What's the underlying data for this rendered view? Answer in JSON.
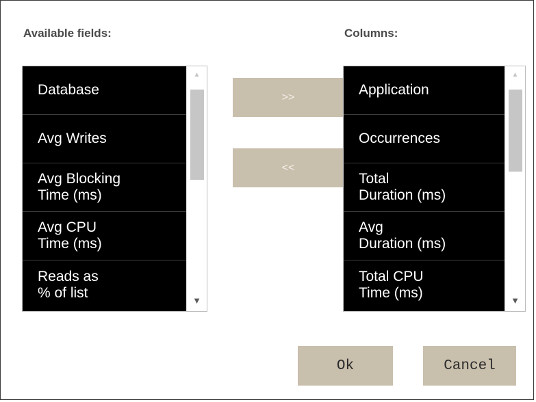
{
  "labels": {
    "available": "Available fields:",
    "columns": "Columns:"
  },
  "available_fields": [
    "Database",
    "Avg Writes",
    "Avg Blocking\nTime (ms)",
    "Avg CPU\nTime (ms)",
    "Reads as\n% of list"
  ],
  "columns": [
    "Application",
    "Occurrences",
    "Total\nDuration (ms)",
    "Avg\nDuration (ms)",
    "Total CPU\nTime (ms)"
  ],
  "buttons": {
    "add": ">>",
    "remove": "<<",
    "ok": "Ok",
    "cancel": "Cancel"
  },
  "colors": {
    "button_bg": "#c9bfad",
    "list_bg": "#000000",
    "list_text": "#ffffff"
  }
}
